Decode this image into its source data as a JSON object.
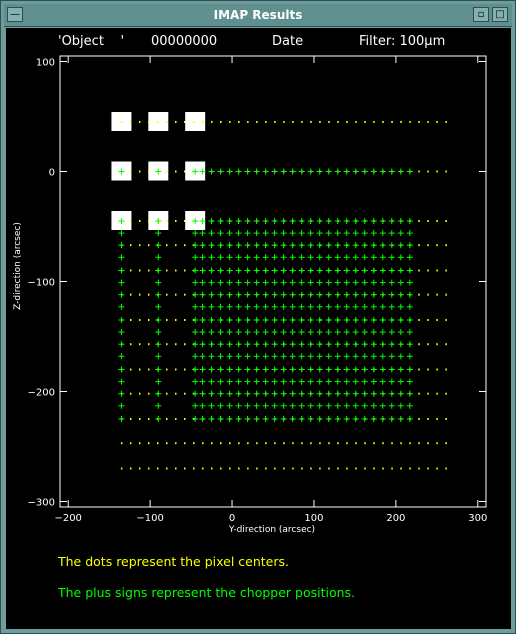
{
  "window": {
    "title": "IMAP Results",
    "buttons": {
      "minimize": "—",
      "restore": "▫",
      "maximize": "□"
    }
  },
  "header": {
    "object_label": "'Object    '",
    "object_id": "00000000",
    "date_label": "Date",
    "filter_label": "Filter: 100μm"
  },
  "legend": {
    "dots_text": "The dots represent the pixel centers.",
    "plus_text": "The plus signs represent the chopper positions."
  },
  "colors": {
    "background": "#000000",
    "frame": "#ffffff",
    "dots": "#ffff00",
    "plus": "#00ff00",
    "squares": "#ffffff"
  },
  "chart_data": {
    "type": "scatter",
    "title": "",
    "xlabel": "Y-direction (arcsec)",
    "ylabel": "Z-direction (arcsec)",
    "xlim": [
      -210,
      310
    ],
    "ylim": [
      -305,
      105
    ],
    "xticks": [
      -200,
      -100,
      0,
      100,
      200,
      300
    ],
    "yticks": [
      100,
      0,
      -100,
      -200,
      -300
    ],
    "xtick_labels": [
      "−200",
      "−100",
      "0",
      "100",
      "200",
      "300"
    ],
    "ytick_labels": [
      "100",
      "0",
      "−100",
      "−200",
      "−300"
    ],
    "grid": false,
    "pixel_centers": {
      "x_values": [
        -135,
        -124,
        -113,
        -102,
        -91,
        -80,
        -69,
        -58,
        -47,
        -36,
        -25,
        -14,
        -3,
        8,
        19,
        30,
        41,
        52,
        63,
        74,
        85,
        96,
        107,
        118,
        129,
        140,
        151,
        162,
        173,
        184,
        195,
        206,
        217,
        228,
        239,
        250,
        261
      ],
      "y_values": [
        45,
        0,
        -45,
        -67,
        -90,
        -112,
        -135,
        -157,
        -180,
        -202,
        -225,
        -247,
        -270
      ]
    },
    "chopper_positions": {
      "x_values": [
        -135,
        -90,
        -45,
        -36,
        -25,
        -14,
        -3,
        8,
        19,
        30,
        41,
        52,
        63,
        74,
        85,
        96,
        107,
        118,
        129,
        140,
        151,
        162,
        173,
        184,
        195,
        206,
        217
      ],
      "y_values": [
        0,
        -45,
        -56,
        -67,
        -78,
        -90,
        -101,
        -112,
        -123,
        -135,
        -146,
        -157,
        -168,
        -180,
        -191,
        -202,
        -213,
        -225
      ]
    },
    "squares": [
      {
        "x": -135,
        "y": 45
      },
      {
        "x": -90,
        "y": 45
      },
      {
        "x": -45,
        "y": 45
      },
      {
        "x": -135,
        "y": 0
      },
      {
        "x": -90,
        "y": 0
      },
      {
        "x": -45,
        "y": 0
      },
      {
        "x": -135,
        "y": -45
      },
      {
        "x": -90,
        "y": -45
      },
      {
        "x": -45,
        "y": -45
      }
    ]
  }
}
